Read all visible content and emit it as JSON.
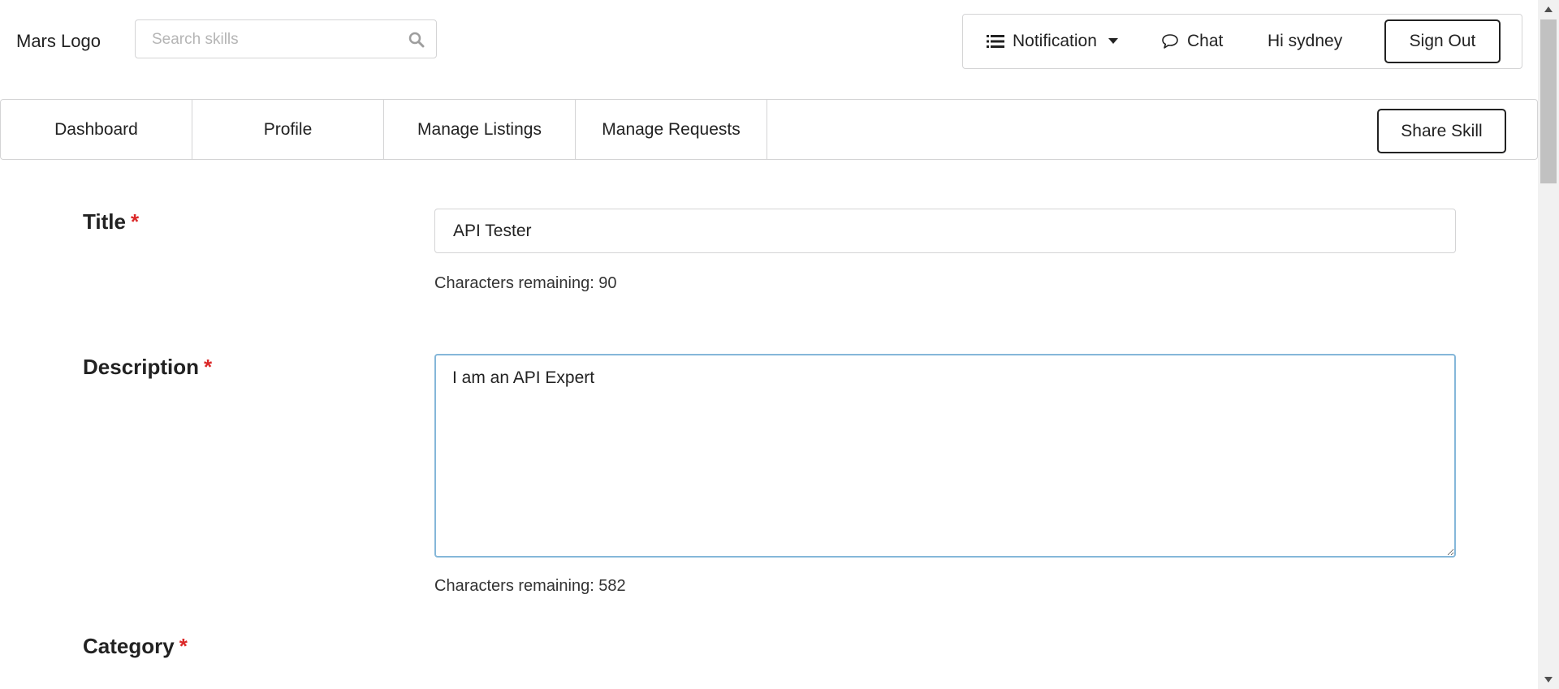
{
  "header": {
    "logo_text": "Mars Logo",
    "search": {
      "placeholder": "Search skills",
      "value": ""
    },
    "user_menu": {
      "notification_label": "Notification",
      "chat_label": "Chat",
      "greeting": "Hi sydney",
      "sign_out_label": "Sign Out"
    }
  },
  "nav": {
    "tabs": [
      {
        "label": "Dashboard"
      },
      {
        "label": "Profile"
      },
      {
        "label": "Manage Listings"
      },
      {
        "label": "Manage Requests"
      }
    ],
    "share_skill_label": "Share Skill"
  },
  "form": {
    "required_marker": "*",
    "title": {
      "label": "Title",
      "value": "API Tester",
      "hint": "Characters remaining: 90"
    },
    "description": {
      "label": "Description",
      "value": "I am an API Expert",
      "hint": "Characters remaining: 582"
    },
    "category": {
      "label": "Category"
    }
  },
  "colors": {
    "required": "#db2828",
    "focus_border": "#85b7d9",
    "border": "#d4d4d5"
  }
}
